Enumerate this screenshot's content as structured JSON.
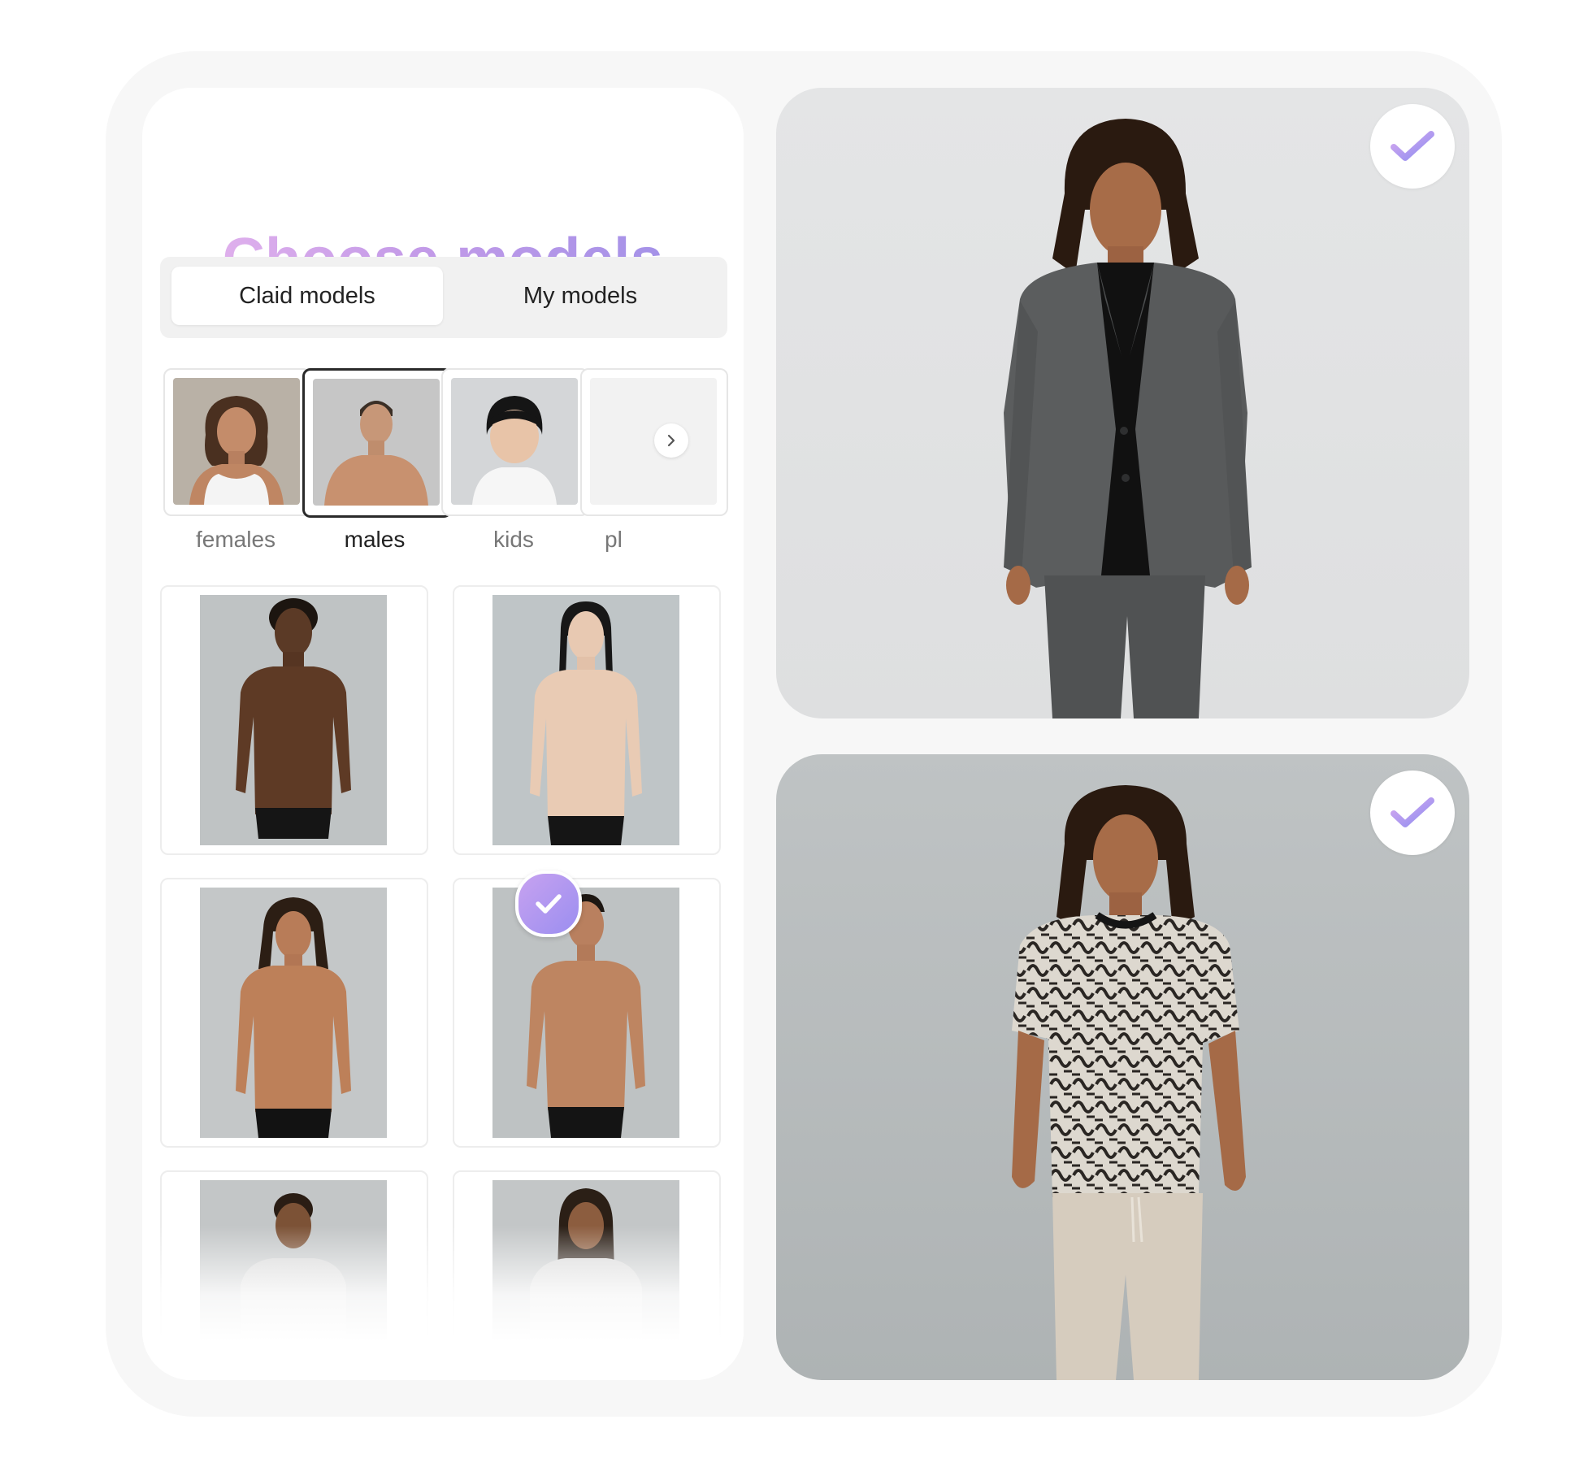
{
  "panel": {
    "title": "Choose models",
    "tabs": [
      {
        "label": "Claid models",
        "active": true
      },
      {
        "label": "My models",
        "active": false
      }
    ],
    "categories": [
      {
        "label": "females",
        "selected": false
      },
      {
        "label": "males",
        "selected": true
      },
      {
        "label": "kids",
        "selected": false
      },
      {
        "label": "pl",
        "selected": false
      }
    ],
    "next_icon": "chevron-right-icon",
    "selected_model_index": 2,
    "accent_gradient": [
      "#eab8ee",
      "#9a8fe8"
    ]
  },
  "previews": [
    {
      "selected": true,
      "icon": "check-icon"
    },
    {
      "selected": true,
      "icon": "check-icon"
    }
  ]
}
